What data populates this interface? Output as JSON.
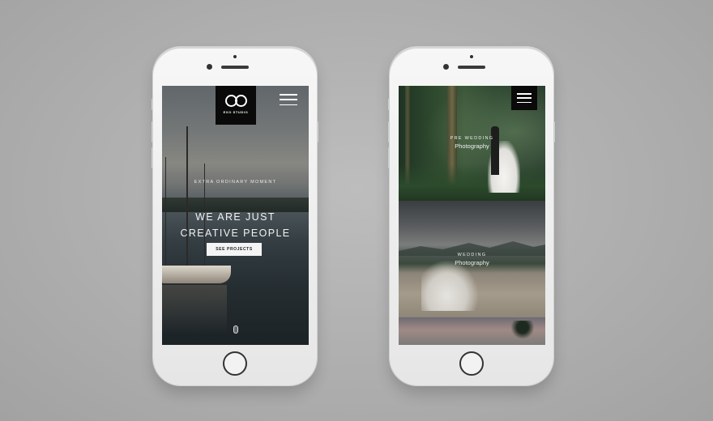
{
  "left_phone": {
    "logo": {
      "text": "EXO STUDIO",
      "icon": "infinity-rings-icon"
    },
    "menu_icon": "hamburger-menu-icon",
    "tagline": "EXTRA ORDINARY MOMENT",
    "headline_line1": "WE ARE JUST",
    "headline_line2": "CREATIVE PEOPLE",
    "cta_label": "SEE PROJECTS",
    "scroll_icon": "scroll-mouse-icon"
  },
  "right_phone": {
    "menu_icon": "hamburger-menu-icon",
    "tiles": [
      {
        "small": "PRE WEDDING",
        "big": "Photography"
      },
      {
        "small": "WEDDING",
        "big": "Photography"
      },
      {
        "small": "",
        "big": ""
      }
    ]
  },
  "colors": {
    "background": "#adadad",
    "phone_body": "#eeeeee",
    "logo_bg": "#0a0a0a",
    "cta_bg": "#f4f4f4"
  }
}
